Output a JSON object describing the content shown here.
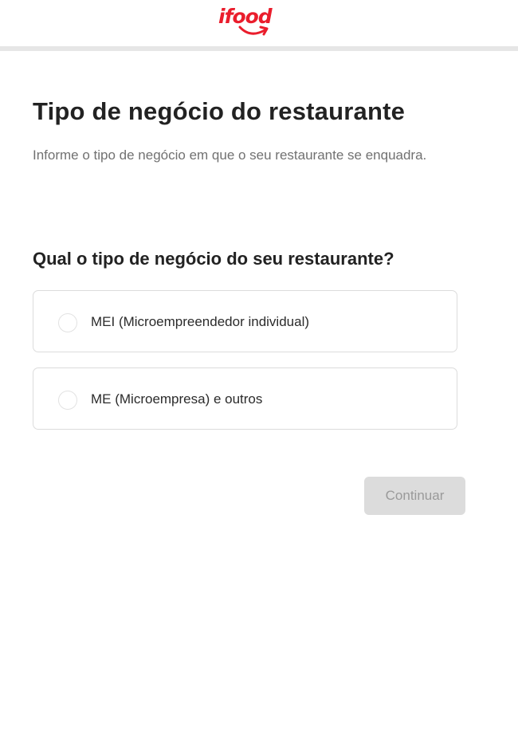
{
  "header": {
    "logo_text": "ifood",
    "logo_color": "#ea1d2c"
  },
  "page": {
    "title": "Tipo de negócio do restaurante",
    "subtitle": "Informe o tipo de negócio em que o seu restaurante se enquadra."
  },
  "question": {
    "text": "Qual o tipo de negócio do seu restaurante?",
    "options": [
      {
        "label": "MEI (Microempreendedor individual)",
        "selected": false
      },
      {
        "label": "ME (Microempresa) e outros",
        "selected": false
      }
    ]
  },
  "actions": {
    "continue_label": "Continuar",
    "continue_disabled": true
  }
}
